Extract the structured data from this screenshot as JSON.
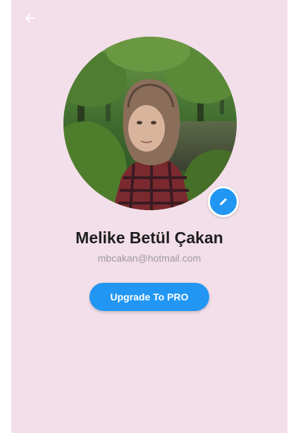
{
  "header": {
    "back_icon": "arrow-left-icon"
  },
  "profile": {
    "avatar_alt": "profile photo",
    "edit_icon": "pencil-icon",
    "name": "Melike Betül Çakan",
    "email": "mbcakan@hotmail.com"
  },
  "actions": {
    "upgrade_label": "Upgrade To PRO"
  },
  "colors": {
    "background": "#f3dfe9",
    "accent": "#2196f3",
    "name_text": "#1f1f1f",
    "email_text": "#9a9a9a"
  }
}
